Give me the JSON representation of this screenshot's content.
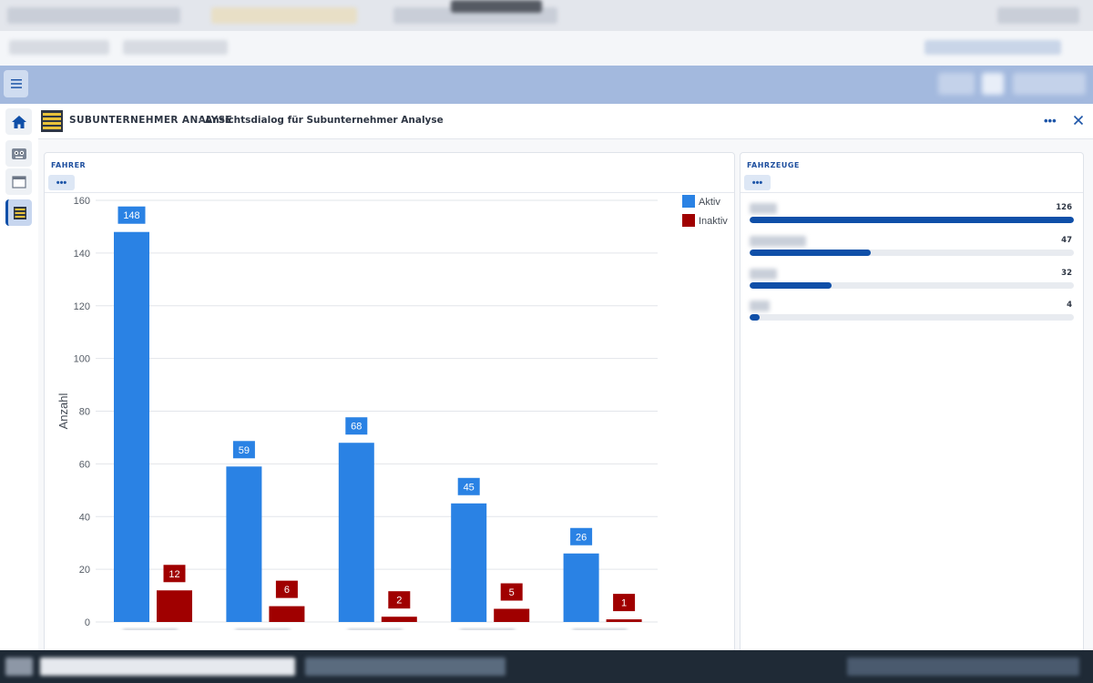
{
  "app": {
    "name": "SUBUNTERNEHMER ANALYSE",
    "separator": "›",
    "page_title": "Ansichtsdialog für Subunternehmer Analyse"
  },
  "icons": {
    "menu": "hamburger-icon",
    "home": "home-icon",
    "robot": "robot-icon",
    "window": "window-icon",
    "analysis": "analysis-list-icon",
    "more": "more-horizontal-icon",
    "close": "close-icon"
  },
  "colors": {
    "primary": "#0f4fa8",
    "aktiv": "#2a82e4",
    "inaktiv": "#a00000",
    "app_bar": "#a3b9de"
  },
  "header": {
    "more_label": "•••"
  },
  "fahrer": {
    "title": "FAHRER",
    "more_label": "•••"
  },
  "fahrzeuge": {
    "title": "FAHRZEUGE",
    "more_label": "•••",
    "items": [
      {
        "value": "126",
        "fraction": 1.0
      },
      {
        "value": "47",
        "fraction": 0.373
      },
      {
        "value": "32",
        "fraction": 0.254
      },
      {
        "value": "4",
        "fraction": 0.032
      }
    ]
  },
  "chart_data": {
    "type": "bar",
    "categories": [
      "",
      "",
      "",
      "",
      ""
    ],
    "series": [
      {
        "name": "Aktiv",
        "values": [
          148,
          59,
          68,
          45,
          26
        ],
        "color": "#2a82e4"
      },
      {
        "name": "Inaktiv",
        "values": [
          12,
          6,
          2,
          5,
          1
        ],
        "color": "#a00000"
      }
    ],
    "xlabel": "",
    "ylabel": "Anzahl",
    "ylim": [
      0,
      160
    ],
    "yticks": [
      0,
      20,
      40,
      60,
      80,
      100,
      120,
      140,
      160
    ],
    "grid": true,
    "legend": "top-right",
    "data_labels": true
  }
}
